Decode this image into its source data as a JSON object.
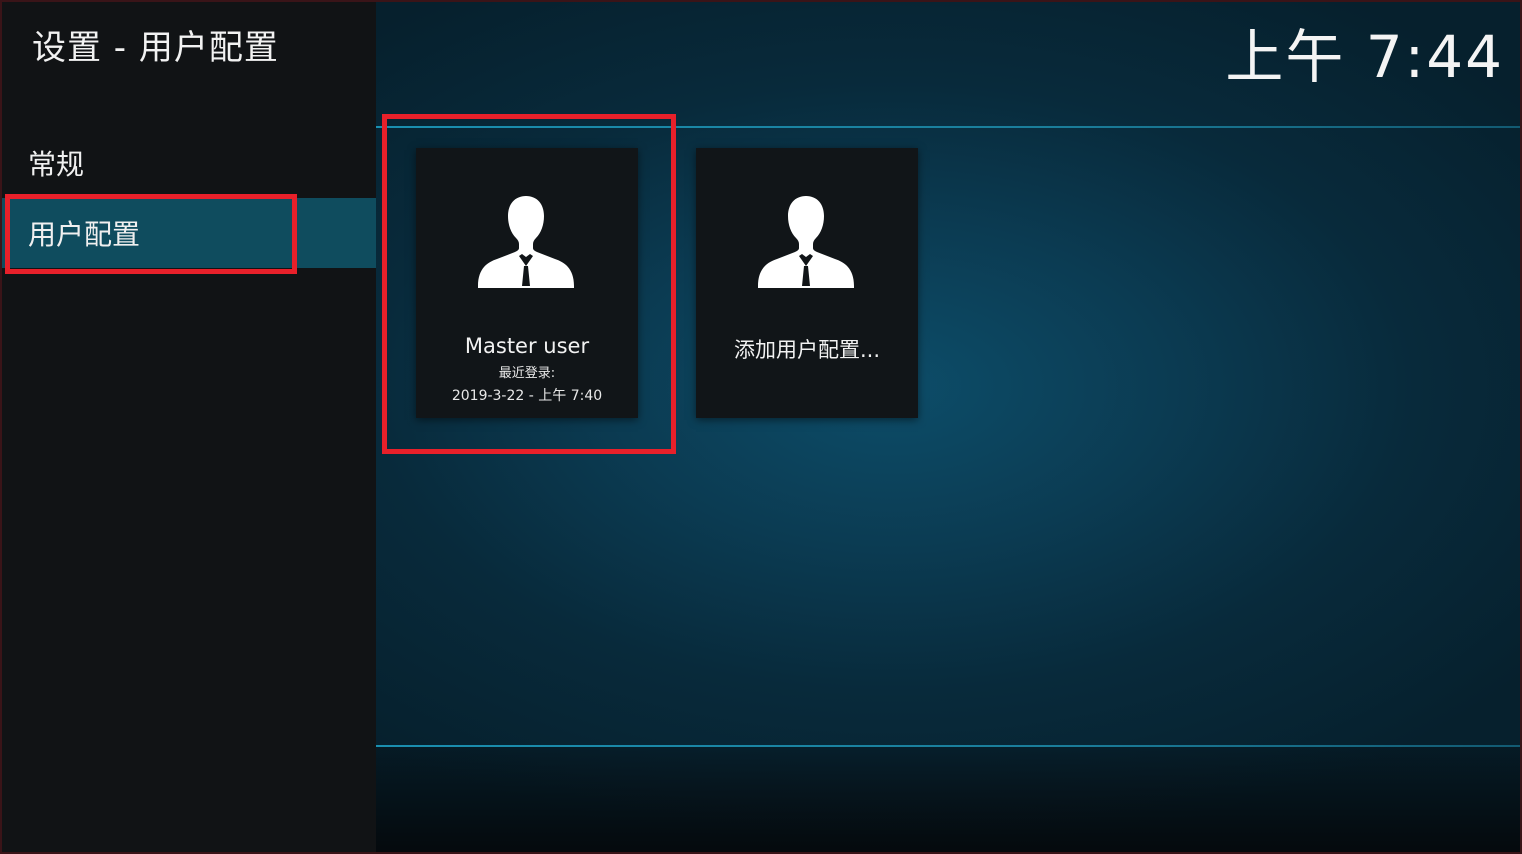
{
  "header": {
    "title": "设置 - 用户配置",
    "clock": "上午 7:44"
  },
  "sidebar": {
    "items": [
      {
        "label": "常规",
        "selected": false
      },
      {
        "label": "用户配置",
        "selected": true
      }
    ]
  },
  "profiles": [
    {
      "name": "Master user",
      "last_login_label": "最近登录:",
      "last_login_value": "2019-3-22 - 上午 7:40",
      "icon": "user-icon"
    },
    {
      "name": "添加用户配置...",
      "icon": "user-icon"
    }
  ],
  "colors": {
    "highlight": "#e8202a",
    "selected_item": "#0f4c5e",
    "accent_line": "#1a8fb0"
  }
}
